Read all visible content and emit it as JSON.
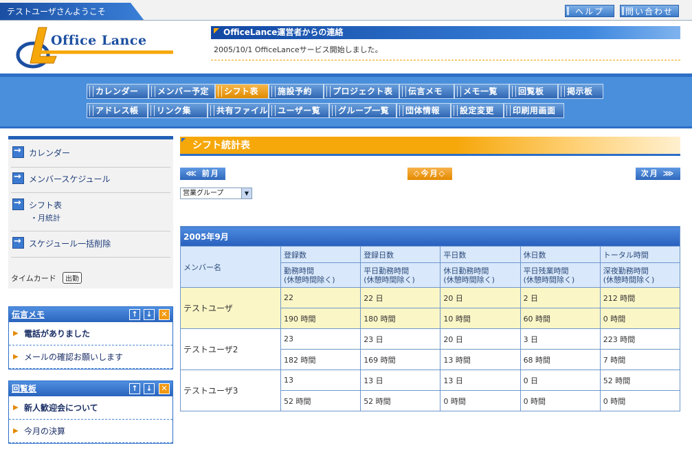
{
  "topbar": {
    "welcome": "テストユーザさんようこそ",
    "help": "ヘルプ",
    "contact": "問い合わせ"
  },
  "logo": {
    "text": "Office Lance"
  },
  "notice": {
    "title": "OfficeLance運営者からの連絡",
    "body": "2005/10/1 OfficeLanceサービス開始しました。"
  },
  "nav": {
    "row1": [
      "カレンダー",
      "メンバー予定",
      "シフト表",
      "施設予約",
      "プロジェクト表",
      "伝言メモ",
      "メモ一覧",
      "回覧板",
      "掲示板"
    ],
    "row2": [
      "アドレス帳",
      "リンク集",
      "共有ファイル",
      "ユーザー覧",
      "グループ一覧",
      "団体情報",
      "設定変更",
      "印刷用画面"
    ],
    "active": "シフト表"
  },
  "sidebar": {
    "items": [
      "カレンダー",
      "メンバースケジュール",
      "シフト表",
      "スケジュール一括削除"
    ],
    "subitem": "・月統計",
    "timecard": "タイムカード",
    "stamp": "出勤"
  },
  "memo": {
    "title": "伝言メモ",
    "items": [
      "電話がありました",
      "メールの確認お願いします"
    ]
  },
  "circular": {
    "title": "回覧板",
    "items": [
      "新人歓迎会について",
      "今月の決算"
    ]
  },
  "main": {
    "title": "シフト統計表",
    "prev": "前月",
    "current": "今月",
    "next": "次月",
    "group": "営業グループ",
    "month": "2005年9月"
  },
  "table": {
    "member_header": "メンバー名",
    "header1": [
      "登録数",
      "登録日数",
      "平日数",
      "休日数",
      "トータル時間"
    ],
    "header2": [
      [
        "勤務時間",
        "(休憩時間除く)"
      ],
      [
        "平日勤務時間",
        "(休憩時間除く)"
      ],
      [
        "休日勤務時間",
        "(休憩時間除く)"
      ],
      [
        "平日残業時間",
        "(休憩時間除く)"
      ],
      [
        "深夜勤務時間",
        "(休憩時間除く)"
      ]
    ],
    "rows": [
      {
        "name": "テストユーザ",
        "r1": [
          "22",
          "22 日",
          "20 日",
          "2 日",
          "212 時間"
        ],
        "r2": [
          "190 時間",
          "180 時間",
          "10 時間",
          "60 時間",
          "0 時間"
        ]
      },
      {
        "name": "テストユーザ2",
        "r1": [
          "23",
          "23 日",
          "20 日",
          "3 日",
          "223 時間"
        ],
        "r2": [
          "182 時間",
          "169 時間",
          "13 時間",
          "68 時間",
          "7 時間"
        ]
      },
      {
        "name": "テストユーザ3",
        "r1": [
          "13",
          "13 日",
          "13 日",
          "0 日",
          "52 時間"
        ],
        "r2": [
          "52 時間",
          "52 時間",
          "0 時間",
          "0 時間",
          "0 時間"
        ]
      }
    ]
  },
  "colors": {
    "primary_blue": "#2d6ec7",
    "accent_orange": "#f6a70a",
    "highlight_yellow": "#fbf6c6"
  }
}
